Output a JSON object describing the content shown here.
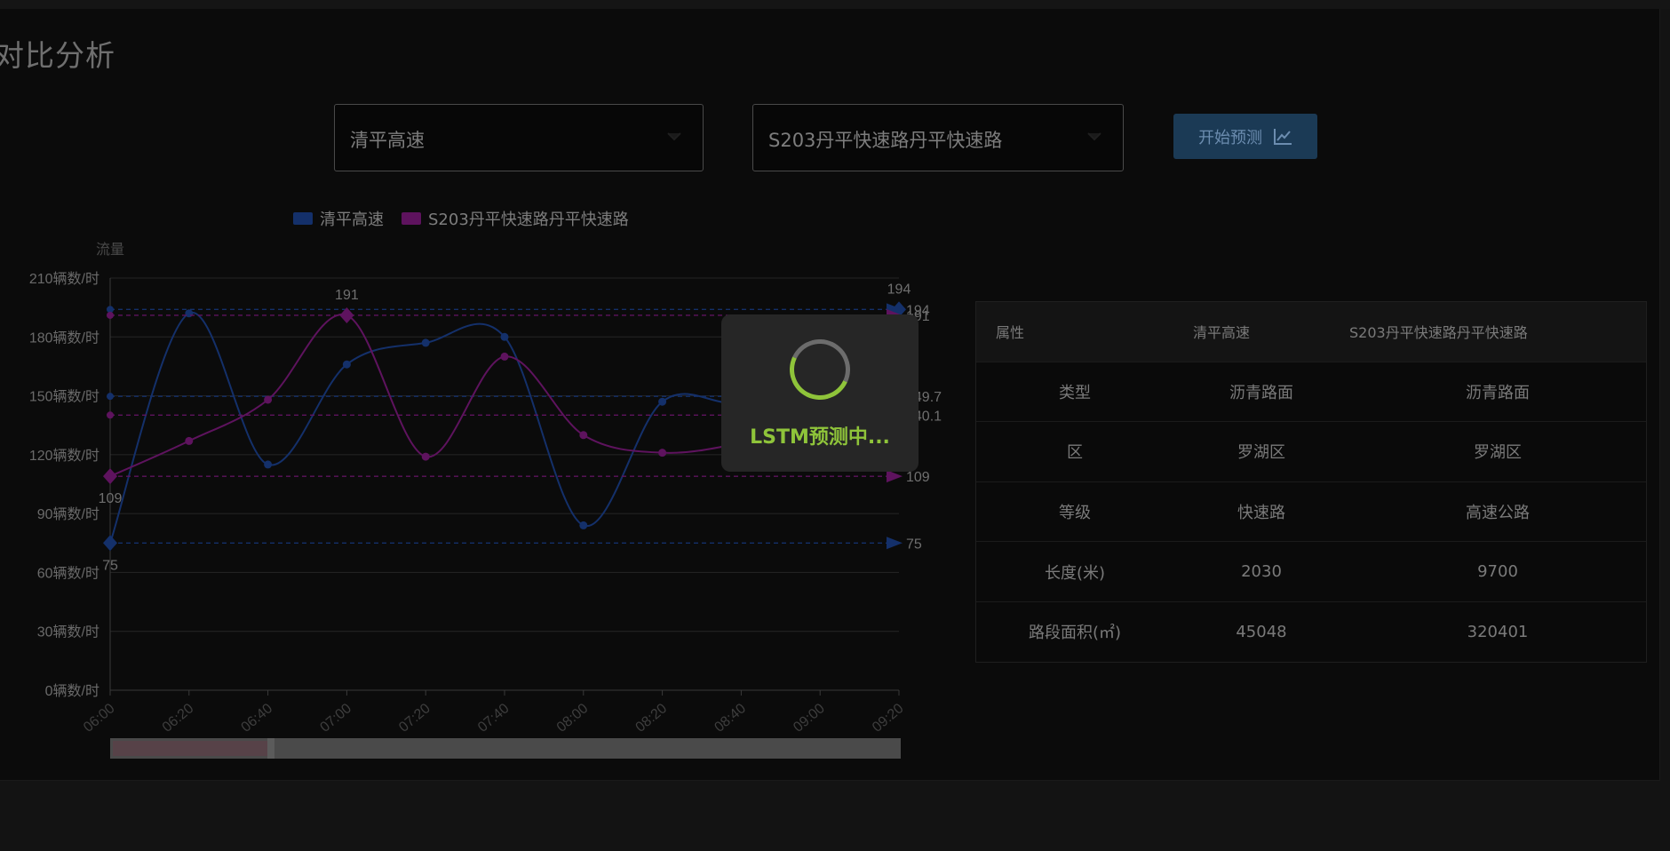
{
  "page": {
    "title": "对比分析"
  },
  "controls": {
    "road_a": "清平高速",
    "road_b": "S203丹平快速路丹平快速路",
    "predict_label": "开始预测"
  },
  "loading": {
    "text": "LSTM预测中..."
  },
  "colors": {
    "series_a": "#14306a",
    "series_b": "#5e135e",
    "accent": "#8fc43a",
    "button": "#1b3a55"
  },
  "chart_data": {
    "type": "line",
    "ylabel": "流量",
    "y_unit": "辆数/时",
    "ylim": [
      0,
      210
    ],
    "y_ticks": [
      "0辆数/时",
      "30辆数/时",
      "60辆数/时",
      "90辆数/时",
      "120辆数/时",
      "150辆数/时",
      "180辆数/时",
      "210辆数/时"
    ],
    "y_tick_values": [
      0,
      30,
      60,
      90,
      120,
      150,
      180,
      210
    ],
    "categories": [
      "06:00",
      "06:20",
      "06:40",
      "07:00",
      "07:20",
      "07:40",
      "08:00",
      "08:20",
      "08:40",
      "09:00",
      "09:20"
    ],
    "legend": [
      "清平高速",
      "S203丹平快速路丹平快速路"
    ],
    "legend_position": "top",
    "grid": true,
    "series": [
      {
        "name": "清平高速",
        "values": [
          75,
          192,
          115,
          166,
          177,
          180,
          84,
          147,
          147,
          170,
          194
        ],
        "max": {
          "value": 194,
          "index": 10,
          "label": "194"
        },
        "min": {
          "value": 75,
          "index": 0,
          "label": "75"
        },
        "avg": {
          "value": 149.73,
          "label": "149.7"
        }
      },
      {
        "name": "S203丹平快速路丹平快速路",
        "values": [
          109,
          127,
          148,
          191,
          119,
          170,
          130,
          121,
          126,
          137,
          164
        ],
        "max": {
          "value": 191,
          "index": 3,
          "label": "191"
        },
        "min": {
          "value": 109,
          "index": 0,
          "label": "109"
        },
        "avg": {
          "value": 140.18,
          "label": "140.1"
        }
      }
    ]
  },
  "attributes_table": {
    "headers": [
      "属性",
      "清平高速",
      "S203丹平快速路丹平快速路"
    ],
    "rows": [
      [
        "类型",
        "沥青路面",
        "沥青路面"
      ],
      [
        "区",
        "罗湖区",
        "罗湖区"
      ],
      [
        "等级",
        "快速路",
        "高速公路"
      ],
      [
        "长度(米)",
        "2030",
        "9700"
      ],
      [
        "路段面积(㎡)",
        "45048",
        "320401"
      ]
    ]
  }
}
